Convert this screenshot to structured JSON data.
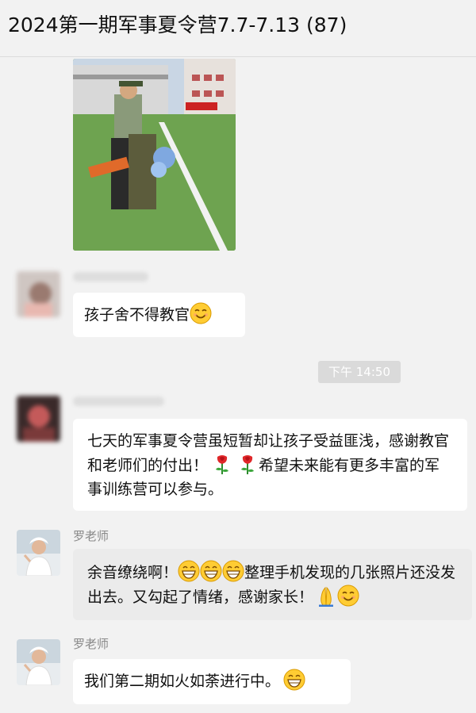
{
  "header": {
    "title": "2024第一期军事夏令营7.7-7.13 (87)"
  },
  "messages": [
    {
      "sender": "",
      "type": "image",
      "description": ""
    },
    {
      "sender": "",
      "text": "孩子舍不得教官",
      "emoji": [
        "smile-icon"
      ]
    },
    {
      "sender": "",
      "text_parts": [
        "七天的军事夏令营虽短暂却让孩子受益匪浅，感谢教官和老师们的付出！",
        "希望未来能有更多丰富的军事训练营可以参与。"
      ],
      "emoji": [
        "rose-icon",
        "rose-icon"
      ]
    },
    {
      "sender": "罗老师",
      "text_parts": [
        "余音缭绕啊！",
        "整理手机发现的几张照片还没发出去。又勾起了情绪，感谢家长！"
      ],
      "emoji": [
        "grin-icon",
        "grin-icon",
        "grin-icon",
        "pray-icon",
        "smile-icon"
      ]
    },
    {
      "sender": "罗老师",
      "text": "我们第二期如火如荼进行中。",
      "emoji": [
        "grin-icon"
      ]
    }
  ],
  "timestamp": "下午 14:50",
  "colors": {
    "background": "#f2f2f2",
    "bubble_in": "#ffffff",
    "bubble_self": "#ebebeb",
    "timestamp_bg": "#dadada"
  }
}
